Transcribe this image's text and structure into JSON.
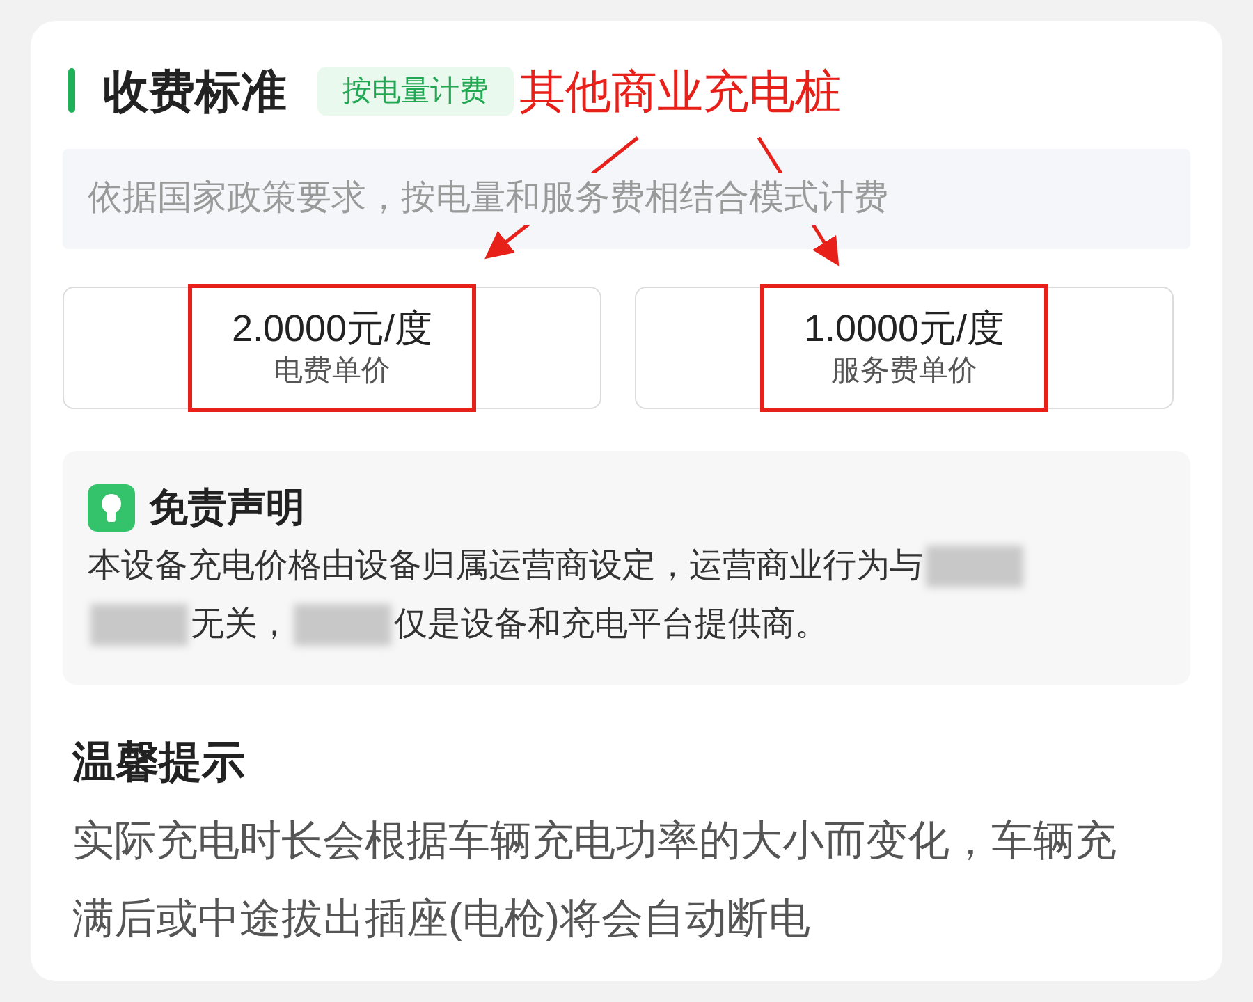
{
  "pricing": {
    "title": "收费标准",
    "badge": "按电量计费",
    "note": "依据国家政策要求，按电量和服务费相结合模式计费",
    "prices": [
      {
        "value": "2.0000元/度",
        "label": "电费单价"
      },
      {
        "value": "1.0000元/度",
        "label": "服务费单价"
      }
    ]
  },
  "annotation": {
    "text": "其他商业充电桩"
  },
  "disclaimer": {
    "title": "免责声明",
    "lines": [
      [
        {
          "kind": "text",
          "text": "本设备充电价格由设备归属运营商设定，运营商业行为与"
        },
        {
          "kind": "blur"
        }
      ],
      [
        {
          "kind": "blur"
        },
        {
          "kind": "text",
          "text": "无关，"
        },
        {
          "kind": "blur"
        },
        {
          "kind": "text",
          "text": "仅是设备和充电平台提供商。"
        }
      ]
    ]
  },
  "tips": {
    "title": "温馨提示",
    "text": "实际充电时长会根据车辆充电功率的大小而变化，车辆充满后或中途拔出插座(电枪)将会自动断电"
  }
}
